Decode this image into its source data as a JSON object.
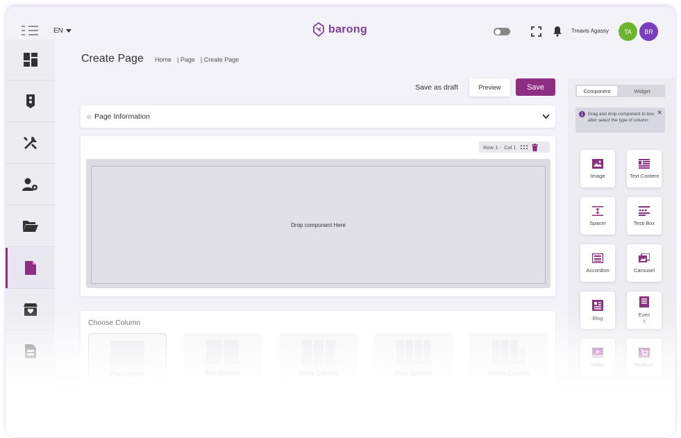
{
  "header": {
    "lang": "EN",
    "brand": "barong",
    "user_name": "Treavis Agassy",
    "avatar1": "TA",
    "avatar2": "BR",
    "avatar1_color": "#6cb52d",
    "avatar2_color": "#7a3dbf"
  },
  "sidebar": {
    "items": [
      {
        "icon": "dashboard-icon"
      },
      {
        "icon": "traffic-light-icon"
      },
      {
        "icon": "tools-icon"
      },
      {
        "icon": "user-settings-icon"
      },
      {
        "icon": "folder-open-icon"
      },
      {
        "icon": "file-icon",
        "active": true
      },
      {
        "icon": "box-heart-icon"
      },
      {
        "icon": "document-list-icon"
      }
    ]
  },
  "page": {
    "title": "Create Page",
    "breadcrumb": [
      "Home",
      "| Page",
      "| Create Page"
    ]
  },
  "actions": {
    "draft": "Save as draft",
    "preview": "Preview",
    "save": "Save",
    "accent": "#8e2e83"
  },
  "page_info": {
    "label": "Page Information"
  },
  "row": {
    "label": "Row 1 -  Col 1",
    "drop_text": "Drop component Here"
  },
  "choose": {
    "title": "Choose Column",
    "options": [
      "One Column",
      "Two Column",
      "Three Column",
      "Four Column",
      "Infinite Column"
    ]
  },
  "right_panel": {
    "tabs": [
      "Component",
      "Widget"
    ],
    "hint": "Drag and drop component to box after select the type of column",
    "components": [
      "Image",
      "Text Content",
      "Spacer",
      "Testi Box",
      "Accordion",
      "Carousel",
      "Blog",
      "Even\nt",
      "Video",
      "Product"
    ]
  }
}
